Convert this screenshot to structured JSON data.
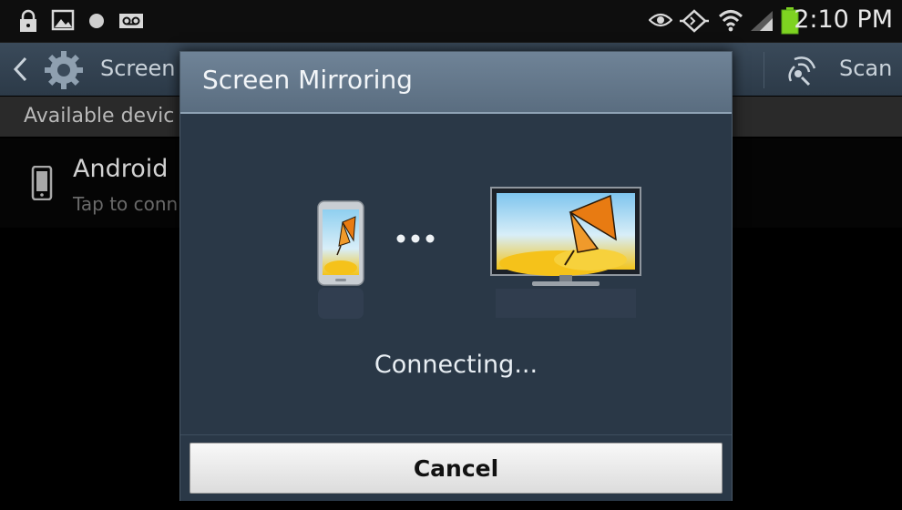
{
  "status_bar": {
    "time": "2:10 PM",
    "icons": [
      "lock-icon",
      "image-icon",
      "record-icon",
      "voicemail-icon",
      "eye-icon",
      "mirroring-icon",
      "wifi-icon",
      "signal-icon",
      "battery-icon"
    ]
  },
  "action_bar": {
    "title": "Screen",
    "scan_label": "Scan",
    "back_icon": "chevron-left-icon",
    "gear_icon": "gear-icon",
    "scan_icon": "scan-icon"
  },
  "section_header": {
    "label": "Available devic"
  },
  "device_list": {
    "items": [
      {
        "name": "Android",
        "subtitle": "Tap to conn",
        "icon": "phone-icon"
      }
    ]
  },
  "dialog": {
    "title": "Screen Mirroring",
    "status": "Connecting...",
    "cancel_label": "Cancel"
  },
  "colors": {
    "dialog_title_bar": "#6f8397",
    "dialog_body": "#2a3847",
    "action_bar": "#3a4a5a",
    "battery": "#7ed321"
  }
}
